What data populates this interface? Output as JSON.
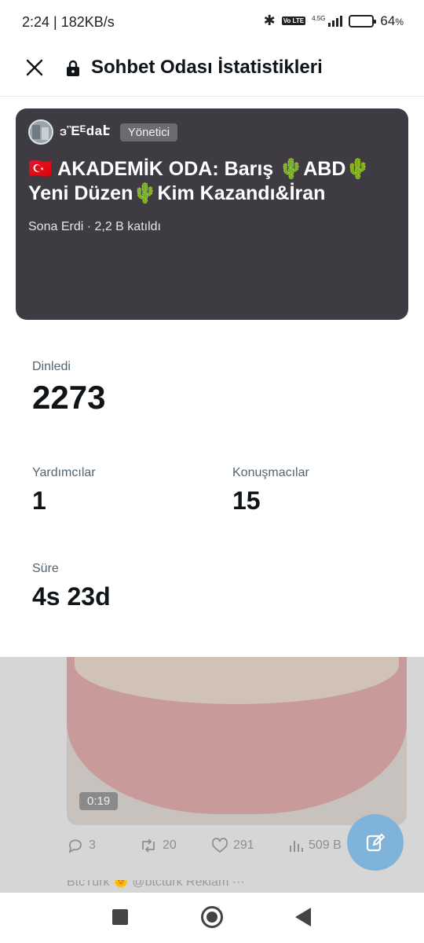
{
  "status_bar": {
    "time": "2:24 | 182KB/s",
    "network_label": "4.5G",
    "volte_label": "Vo LTE",
    "battery": "64",
    "battery_unit": "%"
  },
  "header": {
    "title": "Sohbet Odası İstatistikleri",
    "close_icon": "close-icon",
    "lock_icon": "lock-icon"
  },
  "room": {
    "host_name": "ဒἚᴱdaէ",
    "role": "Yönetici",
    "title": "🇹🇷 AKADEMİK ODA: Barış 🌵ABD🌵 Yeni Düzen🌵Kim Kazandı&İran",
    "meta": "Sona Erdi · 2,2 B katıldı"
  },
  "stats": {
    "listened_label": "Dinledi",
    "listened_value": "2273",
    "helpers_label": "Yardımcılar",
    "helpers_value": "1",
    "speakers_label": "Konuşmacılar",
    "speakers_value": "15",
    "duration_label": "Süre",
    "duration_value": "4s 23d"
  },
  "feed": {
    "video_duration": "0:19",
    "replies": "3",
    "reposts": "20",
    "likes": "291",
    "views": "509 B",
    "next_row_text": "BtcTurk 🌞 @btcturk                              Reklam ···"
  },
  "colors": {
    "card_bg": "#3e3b42",
    "fab": "#7fb3da",
    "muted_text": "#536471"
  }
}
